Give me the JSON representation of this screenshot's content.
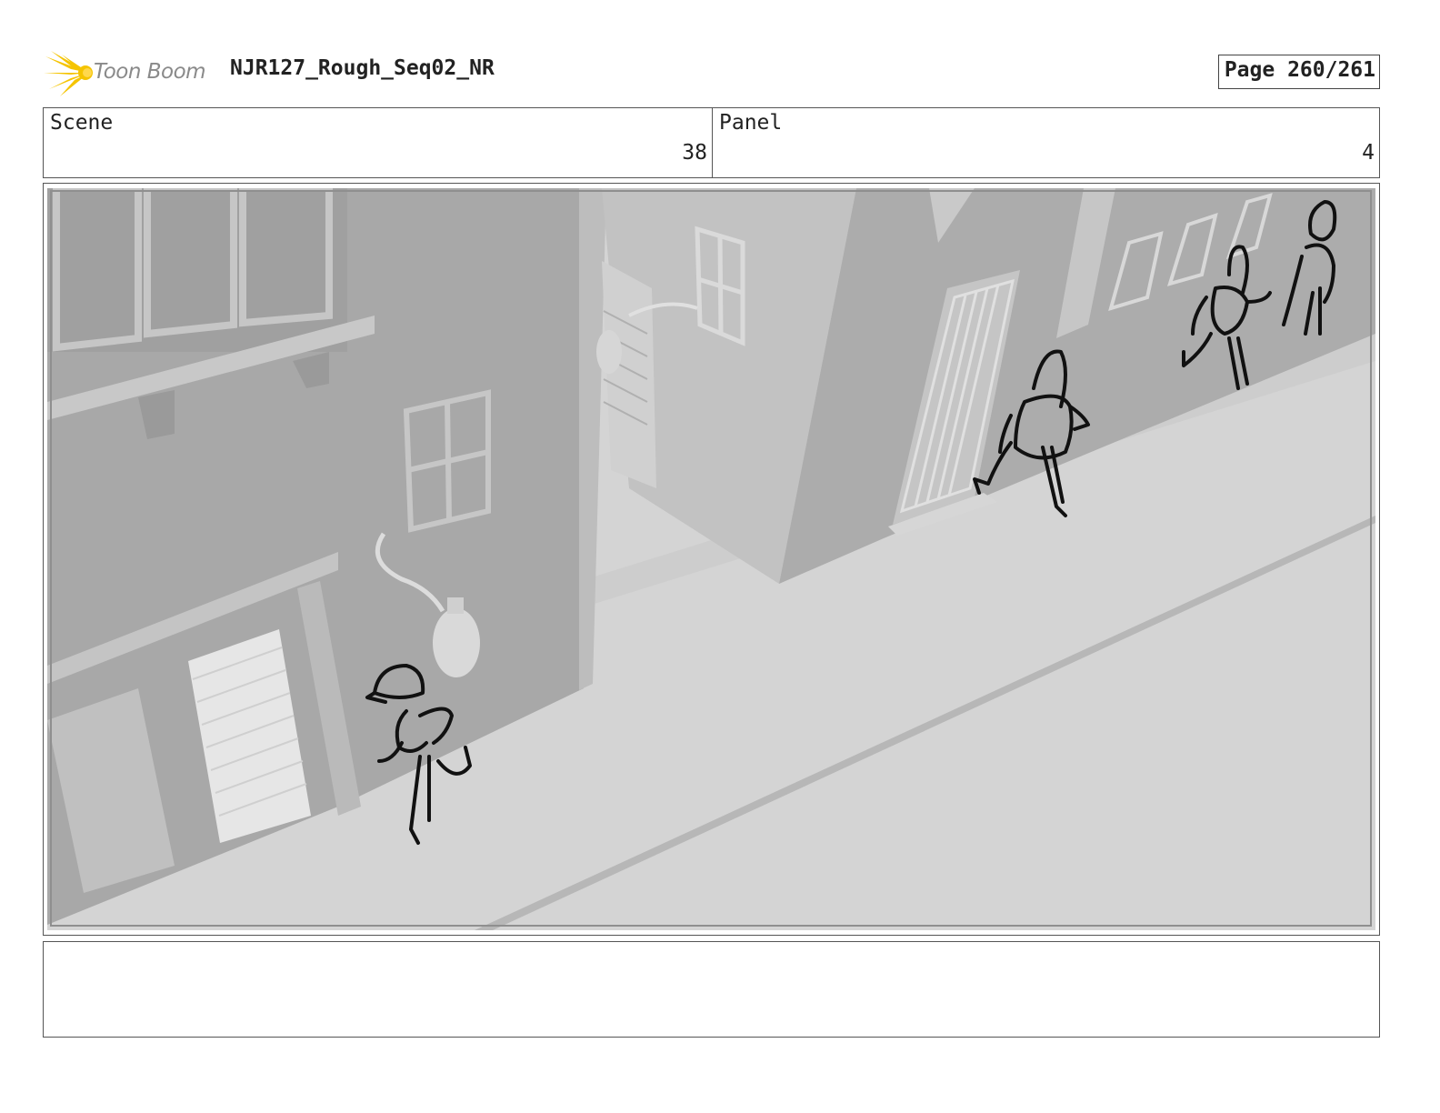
{
  "header": {
    "logo_text": "Toon Boom",
    "title": "NJR127_Rough_Seq02_NR",
    "page": "Page 260/261"
  },
  "info": {
    "scene_label": "Scene",
    "scene_value": "38",
    "panel_label": "Panel",
    "panel_value": "4"
  },
  "colors": {
    "logo_yellow": "#f5c400",
    "street": "#d4d4d4",
    "building_dark": "#a7a7a7",
    "building_mid": "#bcbcbc",
    "sketch": "#111111"
  },
  "notes": {
    "text": ""
  }
}
